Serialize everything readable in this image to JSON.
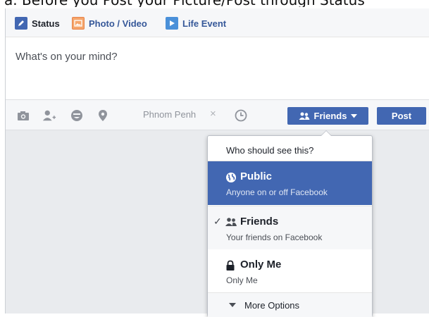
{
  "instruction": "a.   Before you Post your Picture/Post through  Status",
  "composer": {
    "tabs": [
      {
        "label": "Status",
        "icon": "pencil-icon"
      },
      {
        "label": "Photo / Video",
        "icon": "photo-icon"
      },
      {
        "label": "Life Event",
        "icon": "flag-icon"
      }
    ],
    "placeholder": "What's on your mind?",
    "toolbar": {
      "location": "Phnom Penh",
      "remove_location": "×",
      "audience_label": "Friends",
      "post_label": "Post"
    }
  },
  "audience_menu": {
    "header": "Who should see this?",
    "options": [
      {
        "title": "Public",
        "subtitle": "Anyone on or off Facebook",
        "icon": "globe-icon",
        "highlighted": true
      },
      {
        "title": "Friends",
        "subtitle": "Your friends on Facebook",
        "icon": "friends-icon",
        "selected": true
      },
      {
        "title": "Only Me",
        "subtitle": "Only Me",
        "icon": "lock-icon"
      }
    ],
    "more_options": "More Options"
  },
  "colors": {
    "brand": "#4267b2",
    "background": "#e9ebee",
    "link": "#365899"
  }
}
